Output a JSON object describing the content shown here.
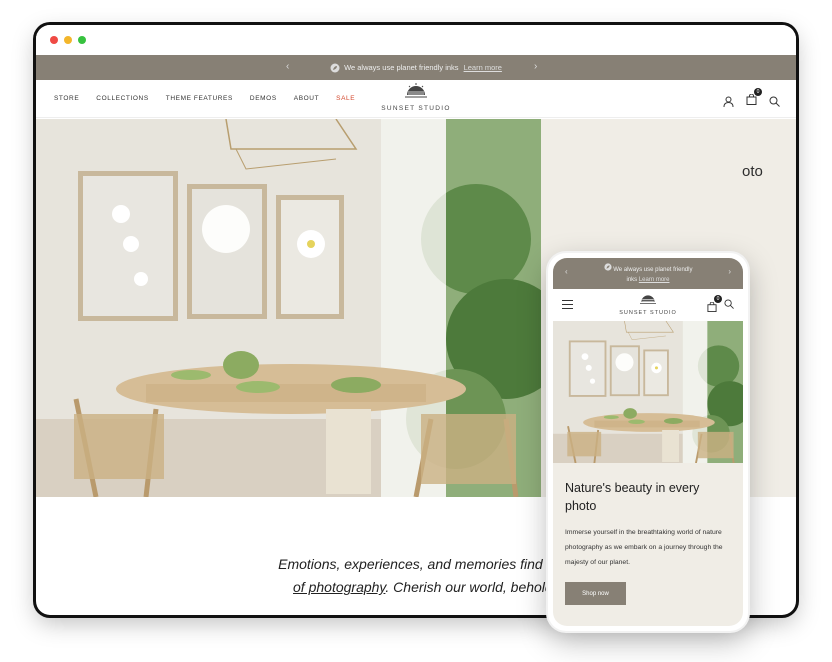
{
  "announcement": {
    "text": "We always use planet friendly inks",
    "link": "Learn more",
    "mobile_line1": "We always use planet friendly",
    "mobile_line2": "inks"
  },
  "nav": {
    "items": [
      "STORE",
      "COLLECTIONS",
      "THEME FEATURES",
      "DEMOS",
      "ABOUT",
      "SALE"
    ],
    "logo": "SUNSET STUDIO",
    "cart_count": "0"
  },
  "hero": {
    "fragment": "oto"
  },
  "tagline": {
    "line1": "Emotions, experiences, and memories find their perfect sar",
    "line2_link": "of photography",
    "line2_rest": ". Cherish our world, behold its breathtal"
  },
  "mobile": {
    "title": "Nature's beauty in every photo",
    "body": "Immerse yourself in the breathtaking world of nature photography as we embark on a journey through the majesty of our planet.",
    "button": "Shop now"
  },
  "colors": {
    "announcement_bg": "#878075",
    "hero_bg": "#f0ede6",
    "sale": "#d3472c"
  }
}
